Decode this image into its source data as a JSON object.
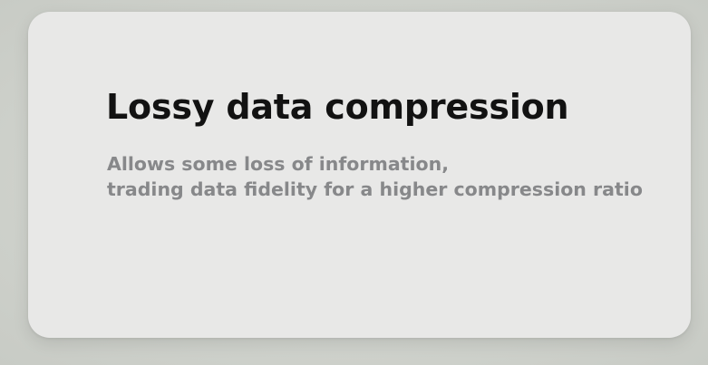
{
  "card": {
    "title": "Lossy data compression",
    "description_lines": [
      "Allows some loss of information,",
      "trading data fidelity for a higher compression ratio"
    ]
  },
  "colors": {
    "background": "#cfd2cc",
    "card": "#e8e8e7",
    "title": "#121212",
    "description": "#87888a"
  }
}
